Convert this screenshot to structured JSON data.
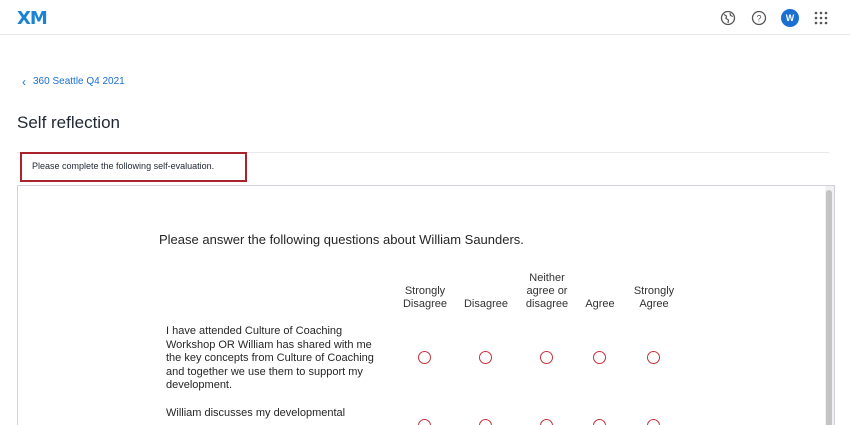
{
  "header": {
    "logo": "XM",
    "avatar_initial": "W",
    "icons": [
      "globe-icon",
      "help-icon",
      "avatar",
      "app-grid-icon"
    ]
  },
  "breadcrumb": {
    "label": "360 Seattle Q4 2021"
  },
  "page": {
    "title": "Self reflection"
  },
  "intro": {
    "text": "Please complete the following self-evaluation."
  },
  "survey": {
    "question": "Please answer the following questions about William Saunders.",
    "scale": [
      "Strongly Disagree",
      "Disagree",
      "Neither agree or disagree",
      "Agree",
      "Strongly Agree"
    ],
    "statements": [
      "I have attended Culture of Coaching Workshop OR William has shared with me the key concepts from Culture of Coaching and together we use them to support my development.",
      "William discusses my developmental"
    ]
  },
  "colors": {
    "accent": "#1a6fd1",
    "logo": "#1a83d4",
    "radio_border": "#c4313a",
    "highlight_border": "#a8232b"
  }
}
